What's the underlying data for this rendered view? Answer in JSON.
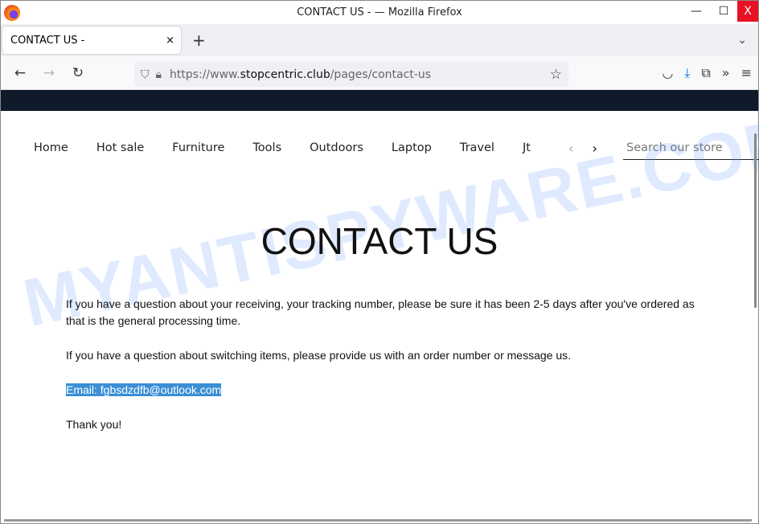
{
  "window": {
    "title": "CONTACT US - — Mozilla Firefox",
    "minimize": "—",
    "maximize": "☐",
    "close": "X"
  },
  "tab": {
    "label": "CONTACT US -",
    "close": "×",
    "new": "+",
    "list": "⌄"
  },
  "nav": {
    "back": "←",
    "forward": "→",
    "reload": "↻",
    "url_prefix": "https://www.",
    "url_domain": "stopcentric.club",
    "url_path": "/pages/contact-us",
    "star": "☆",
    "pocket": "◡",
    "download": "⤓",
    "extensions": "⧉",
    "more": "»",
    "menu": "≡"
  },
  "site": {
    "menu": [
      "Home",
      "Hot sale",
      "Furniture",
      "Tools",
      "Outdoors",
      "Laptop",
      "Travel",
      "Jt"
    ],
    "prev": "‹",
    "next": "›",
    "search_placeholder": "Search our store",
    "heading": "CONTACT US",
    "paragraphs": [
      "If you have a question about your receiving, your tracking number, please be sure it has been 2-5 days after you've ordered as that is the general processing time.",
      "If you have a question about switching items, please provide us with an order number or message us."
    ],
    "email": "Email: fgbsdzdfb@outlook.com",
    "thanks": "Thank you!"
  },
  "watermark": "MYANTISPYWARE.COM"
}
